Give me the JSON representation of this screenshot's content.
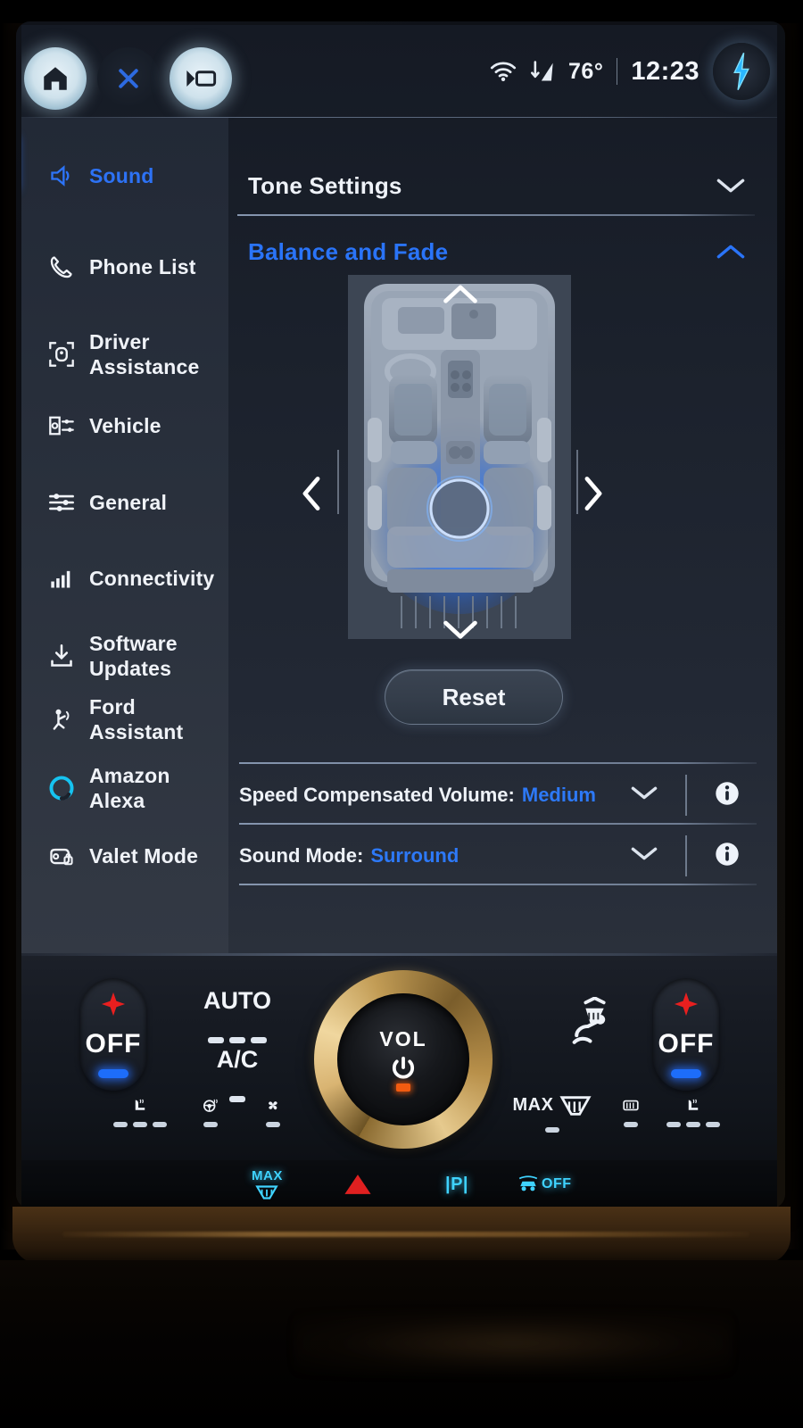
{
  "statusbar": {
    "home_icon": "home-icon",
    "close_icon": "close-x-icon",
    "projection_icon": "projection-icon",
    "wifi_icon": "wifi-icon",
    "nav_icon": "navigation-data-icon",
    "temperature": "76°",
    "clock": "12:23",
    "ev_icon": "ev-charge-bolt-icon"
  },
  "sidebar": {
    "items": [
      {
        "label": "Sound",
        "icon": "speaker-icon",
        "active": true
      },
      {
        "label": "Phone List",
        "icon": "phone-icon",
        "active": false
      },
      {
        "label": "Driver Assistance",
        "icon": "driver-assistance-icon",
        "active": false
      },
      {
        "label": "Vehicle",
        "icon": "vehicle-settings-icon",
        "active": false
      },
      {
        "label": "General",
        "icon": "sliders-icon",
        "active": false
      },
      {
        "label": "Connectivity",
        "icon": "signal-bars-icon",
        "active": false
      },
      {
        "label": "Software Updates",
        "icon": "download-icon",
        "active": false
      },
      {
        "label": "Ford Assistant",
        "icon": "ford-assistant-icon",
        "active": false
      },
      {
        "label": "Amazon Alexa",
        "icon": "alexa-ring-icon",
        "active": false
      },
      {
        "label": "Valet Mode",
        "icon": "valet-lock-icon",
        "active": false
      }
    ]
  },
  "main": {
    "sections": [
      {
        "title": "Tone Settings",
        "expanded": false,
        "chevron": "chevron-down-icon"
      },
      {
        "title": "Balance and Fade",
        "expanded": true,
        "chevron": "chevron-up-icon"
      }
    ],
    "balance_fade": {
      "up_arrow": "chevron-up-icon",
      "down_arrow": "chevron-down-icon",
      "left_arrow": "chevron-left-icon",
      "right_arrow": "chevron-right-icon",
      "diagram": "vehicle-interior-top-view",
      "position_indicator": "sound-position-puck"
    },
    "reset_label": "Reset",
    "settings": [
      {
        "label": "Speed Compensated Volume:",
        "value": "Medium",
        "chevron": "chevron-down-icon",
        "info": "info-icon"
      },
      {
        "label": "Sound Mode:",
        "value": "Surround",
        "chevron": "chevron-down-icon",
        "info": "info-icon"
      }
    ]
  },
  "hvac": {
    "left_rocker": {
      "plus": "+",
      "off_label": "OFF",
      "minus": "−"
    },
    "right_rocker": {
      "plus": "+",
      "off_label": "OFF",
      "minus": "−"
    },
    "auto_label": "AUTO",
    "ac_label": "A/C",
    "airflow_icon": "airflow-person-icon",
    "knob": {
      "label": "VOL",
      "power_icon": "power-icon"
    },
    "left_icons": [
      {
        "name": "heated-seat-icon",
        "dashes": 3
      },
      {
        "name": "heated-steering-wheel-icon",
        "dashes": 1
      },
      {
        "name": "fan-icon",
        "dashes": 1
      }
    ],
    "right_icons": [
      {
        "name": "max-defrost-icon",
        "label": "MAX",
        "dashes": 1
      },
      {
        "name": "rear-defrost-icon",
        "label": "",
        "dashes": 1
      },
      {
        "name": "heated-seat-icon",
        "label": "",
        "dashes": 3
      }
    ]
  },
  "physical_buttons": [
    {
      "name": "max-defrost-button",
      "label": "MAX",
      "color": "#3fd3ff"
    },
    {
      "name": "hazard-button",
      "label": "",
      "color": "#e02020"
    },
    {
      "name": "park-brake-button",
      "label": "|P|",
      "color": "#3fd3ff"
    },
    {
      "name": "park-assist-off-button",
      "label": "OFF",
      "color": "#3fd3ff"
    }
  ],
  "colors": {
    "accent_blue": "#2d74f8",
    "bright_blue": "#1a6dfb",
    "cyan": "#3fd3ff",
    "red": "#e02020",
    "orange": "#f25b10",
    "text": "#f0f3f8"
  }
}
